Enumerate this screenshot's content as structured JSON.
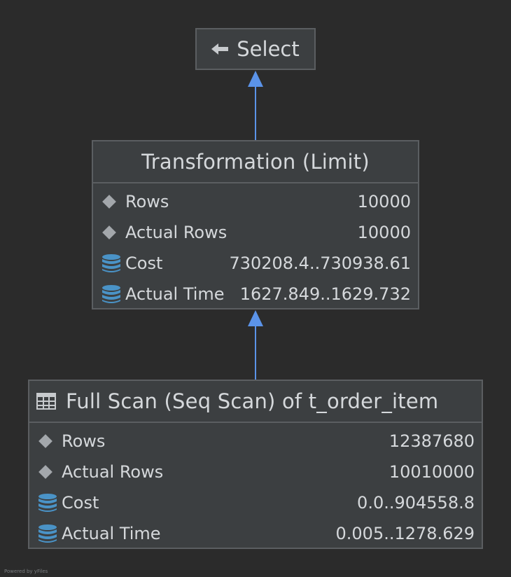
{
  "nodes": {
    "select": {
      "title": "Select",
      "icon": "arrow-left-icon"
    },
    "limit": {
      "title": "Transformation (Limit)",
      "props": [
        {
          "icon": "diamond-icon",
          "name": "Rows",
          "value": "10000"
        },
        {
          "icon": "diamond-icon",
          "name": "Actual Rows",
          "value": "10000"
        },
        {
          "icon": "database-icon",
          "name": "Cost",
          "value": "730208.4..730938.61"
        },
        {
          "icon": "database-icon",
          "name": "Actual Time",
          "value": "1627.849..1629.732"
        }
      ]
    },
    "scan": {
      "title": "Full Scan (Seq Scan) of t_order_item",
      "icon": "table-icon",
      "props": [
        {
          "icon": "diamond-icon",
          "name": "Rows",
          "value": "12387680"
        },
        {
          "icon": "diamond-icon",
          "name": "Actual Rows",
          "value": "10010000"
        },
        {
          "icon": "database-icon",
          "name": "Cost",
          "value": "0.0..904558.8"
        },
        {
          "icon": "database-icon",
          "name": "Actual Time",
          "value": "0.005..1278.629"
        }
      ]
    }
  },
  "edges": [
    {
      "from": "limit",
      "to": "select"
    },
    {
      "from": "scan",
      "to": "limit"
    }
  ],
  "footer": "Powered by yFiles",
  "colors": {
    "background": "#2b2b2b",
    "node_fill": "#3c3f41",
    "node_border": "#5b5e61",
    "edge": "#5b93e8",
    "text": "#d5d8db",
    "icon_db": "#4a93c7",
    "icon_diamond": "#a3a7ab"
  }
}
